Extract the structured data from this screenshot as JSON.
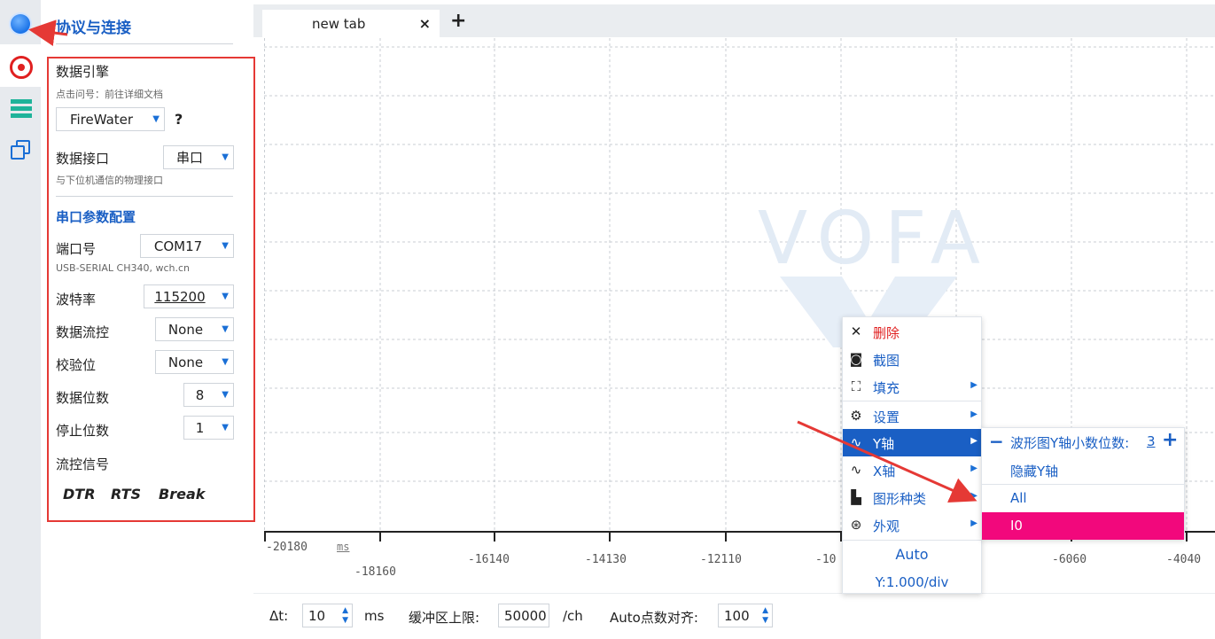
{
  "panel": {
    "title": "协议与连接",
    "engine": {
      "label": "数据引擎",
      "hint": "点击问号：前往详细文档",
      "value": "FireWater",
      "help": "?"
    },
    "interface": {
      "label": "数据接口",
      "value": "串口",
      "hint": "与下位机通信的物理接口"
    },
    "serial_section": "串口参数配置",
    "port": {
      "label": "端口号",
      "value": "COM17",
      "hint": "USB-SERIAL CH340, wch.cn"
    },
    "baud": {
      "label": "波特率",
      "value": "115200"
    },
    "flowctl": {
      "label": "数据流控",
      "value": "None"
    },
    "parity": {
      "label": "校验位",
      "value": "None"
    },
    "databits": {
      "label": "数据位数",
      "value": "8"
    },
    "stopbits": {
      "label": "停止位数",
      "value": "1"
    },
    "signals": {
      "label": "流控信号",
      "dtr": "DTR",
      "rts": "RTS",
      "brk": "Break"
    }
  },
  "tabs": [
    {
      "label": "new tab",
      "close": "×"
    }
  ],
  "tab_add": "+",
  "plot": {
    "watermark": "VOFA",
    "x_unit": "ms",
    "x_ticks_top": [
      "-20180",
      "-10",
      "-4040"
    ],
    "x_ticks_bottom": [
      "-18160",
      "-16140",
      "-14130",
      "-12110",
      "-6060"
    ]
  },
  "bottom": {
    "dt_label": "Δt:",
    "dt_value": "10",
    "dt_unit": "ms",
    "buffer_label": "缓冲区上限:",
    "buffer_value": "50000",
    "buffer_unit": "/ch",
    "align_label": "Auto点数对齐:",
    "align_value": "100"
  },
  "context_menu": {
    "items": [
      {
        "label": "删除",
        "icon": "close-icon"
      },
      {
        "label": "截图",
        "icon": "screenshot-icon"
      },
      {
        "label": "填充",
        "icon": "fill-icon"
      },
      {
        "label": "设置",
        "icon": "wrench-icon"
      },
      {
        "label": "Y轴",
        "icon": "y-axis-wave-icon"
      },
      {
        "label": "X轴",
        "icon": "x-axis-wave-icon"
      },
      {
        "label": "图形种类",
        "icon": "bar-chart-icon"
      },
      {
        "label": "外观",
        "icon": "palette-icon"
      }
    ],
    "auto": "Auto",
    "scale": "Y:1.000/div"
  },
  "y_submenu": {
    "decimals_label": "波形图Y轴小数位数:",
    "decimals_value": "3",
    "hide": "隐藏Y轴",
    "all": "All",
    "channel": "I0"
  },
  "colors": {
    "accent": "#1a5fc4",
    "danger": "#e02020",
    "selected": "#f2087c",
    "annotation": "#e53935"
  }
}
